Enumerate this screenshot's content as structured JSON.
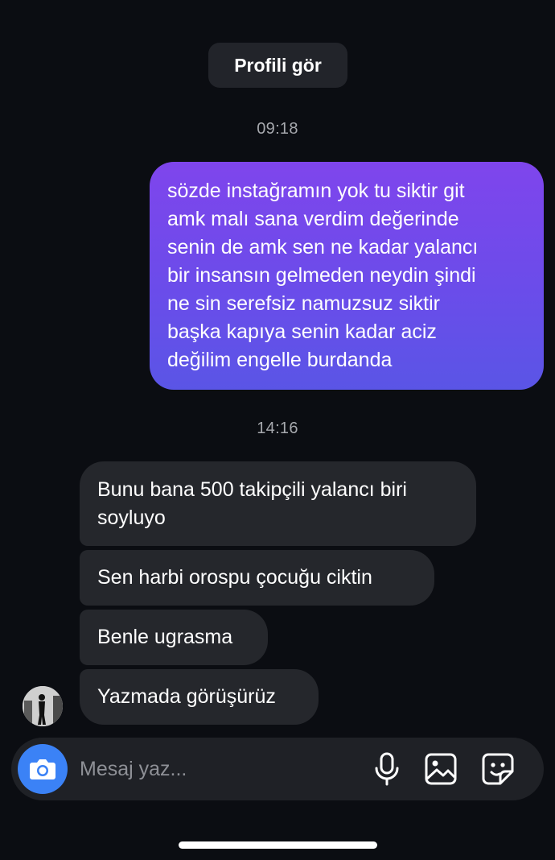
{
  "header": {
    "profile_button_label": "Profili gör"
  },
  "timestamps": [
    "09:18",
    "14:16"
  ],
  "sent_message": {
    "lines": [
      "sözde instağramın yok tu siktir git",
      "amk malı sana verdim değerinde",
      "senin de amk sen ne kadar yalancı",
      "bir insansın gelmeden neydin şindi",
      "ne sin serefsiz namuzsuz siktir",
      "başka kapıya senin kadar aciz",
      "değilim engelle burdanda"
    ],
    "gradient_colors": [
      "#7f45ec",
      "#5a55e6"
    ]
  },
  "received_messages": [
    {
      "lines": [
        "Bunu bana 500 takipçili yalancı biri",
        "soyluyo"
      ]
    },
    {
      "lines": [
        "Sen harbi orospu çocuğu ciktin"
      ]
    },
    {
      "lines": [
        "Benle ugrasma"
      ]
    },
    {
      "lines": [
        "Yazmada görüşürüz"
      ]
    }
  ],
  "composer": {
    "placeholder": "Mesaj yaz...",
    "value": "",
    "icons": [
      "camera-icon",
      "microphone-icon",
      "gallery-icon",
      "sticker-icon"
    ],
    "camera_color": "#3b82f6"
  },
  "colors": {
    "background": "#0b0d12",
    "received_bubble": "#25272c",
    "timestamp": "#a7a9ae"
  }
}
